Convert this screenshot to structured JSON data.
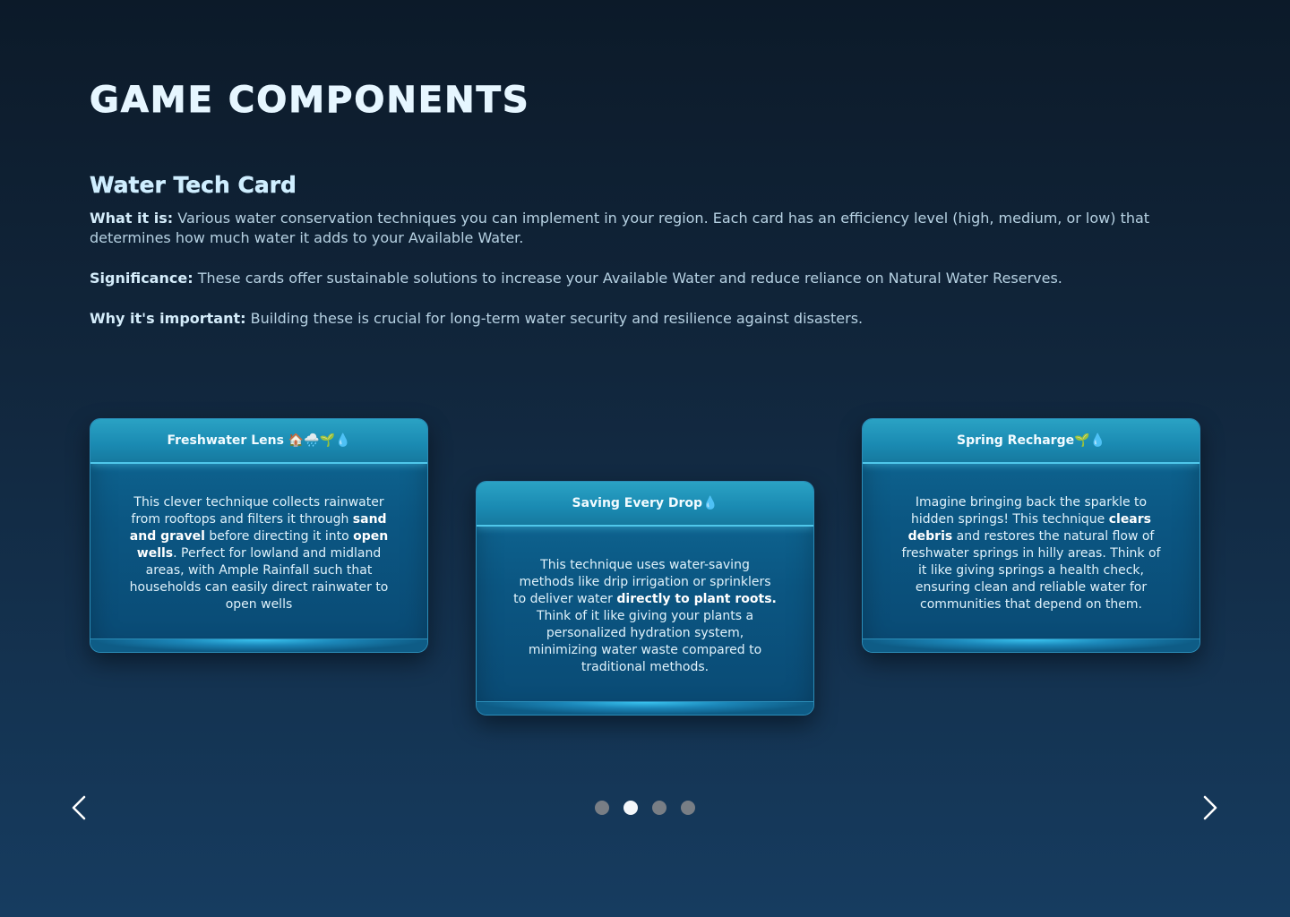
{
  "page": {
    "title": "GAME COMPONENTS"
  },
  "section": {
    "title": "Water Tech Card",
    "what_label": "What it is:",
    "what_text": " Various water conservation techniques you can implement in your region. Each card has an efficiency level (high, medium, or low) that determines how much water it adds to your Available Water.",
    "significance_label": "Significance:",
    "significance_text": " These cards offer sustainable solutions to increase your Available Water and reduce reliance on Natural Water Reserves.",
    "why_label": "Why it's important:",
    "why_text": " Building these is crucial for long-term water security and resilience against disasters."
  },
  "cards": [
    {
      "title": "Freshwater Lens 🏠🌧️🌱💧",
      "body": [
        {
          "t": "This clever technique collects rainwater from rooftops and filters it through ",
          "b": false
        },
        {
          "t": "sand and gravel",
          "b": true
        },
        {
          "t": " before directing it into ",
          "b": false
        },
        {
          "t": "open wells",
          "b": true
        },
        {
          "t": ". Perfect for lowland and midland areas, with Ample Rainfall such that households can easily direct rainwater to open wells",
          "b": false
        }
      ]
    },
    {
      "title": "Saving Every Drop💧",
      "body": [
        {
          "t": "This technique uses water-saving methods like drip irrigation or sprinklers to deliver water ",
          "b": false
        },
        {
          "t": "directly to plant roots.",
          "b": true
        },
        {
          "t": " Think of it like giving your plants a personalized hydration system, minimizing water waste compared to traditional methods.",
          "b": false
        }
      ]
    },
    {
      "title": "Spring Recharge🌱💧",
      "body": [
        {
          "t": "Imagine bringing back the sparkle to hidden springs! This technique ",
          "b": false
        },
        {
          "t": "clears debris",
          "b": true
        },
        {
          "t": " and restores the natural flow of freshwater springs in hilly areas. Think of it like giving springs a health check, ensuring clean and reliable water for communities that depend on them.",
          "b": false
        }
      ]
    }
  ],
  "carousel": {
    "dot_count": 4,
    "active_index": 1,
    "prev_icon": "chevron-left-icon",
    "next_icon": "chevron-right-icon"
  },
  "colors": {
    "dot_active": "#f4f7fa",
    "dot_inactive": "#787e85",
    "card_glow": "#4fc7ea"
  }
}
